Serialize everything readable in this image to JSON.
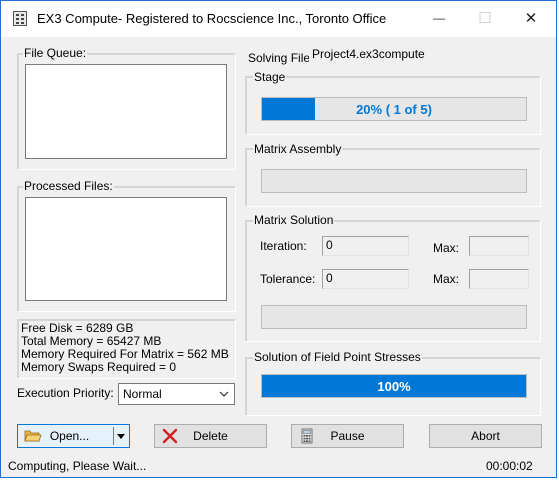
{
  "window": {
    "title": "EX3 Compute- Registered to Rocscience Inc., Toronto Office"
  },
  "titlebar_buttons": {
    "minimize": "—",
    "maximize": "☐",
    "close": "✕"
  },
  "left": {
    "file_queue_label": "File Queue:",
    "processed_files_label": "Processed Files:",
    "memory_info": [
      "Free Disk = 6289 GB",
      "Total Memory = 65427 MB",
      "Memory Required For Matrix = 562 MB",
      "Memory Swaps Required = 0"
    ],
    "execution_priority_label": "Execution Priority:",
    "execution_priority_value": "Normal"
  },
  "right": {
    "solving_file_label": "Solving File:",
    "solving_file_value": "Project4.ex3compute",
    "stage": {
      "label": "Stage",
      "progress_fraction": 0.2,
      "text": "20%   ( 1 of 5)"
    },
    "matrix_assembly": {
      "label": "Matrix Assembly",
      "progress_fraction": 0.0,
      "text": ""
    },
    "matrix_solution": {
      "label": "Matrix Solution",
      "iteration_label": "Iteration:",
      "iteration_value": "0",
      "iteration_max_label": "Max:",
      "iteration_max_value": "",
      "tolerance_label": "Tolerance:",
      "tolerance_value": "0",
      "tolerance_max_label": "Max:",
      "tolerance_max_value": "",
      "progress_fraction": 0.0
    },
    "field_point": {
      "label": "Solution of Field Point Stresses",
      "progress_fraction": 1.0,
      "text": "100%"
    }
  },
  "buttons": {
    "open": "Open...",
    "delete": "Delete",
    "pause": "Pause",
    "abort": "Abort"
  },
  "status": {
    "message": "Computing, Please Wait...",
    "elapsed": "00:00:02"
  },
  "colors": {
    "progress_fill": "#0078d7",
    "progress_text_on_empty": "#0078d7",
    "progress_text_on_fill": "#ffffff",
    "window_border": "#1f6fd0"
  },
  "icons": {
    "app": "grid-app-icon",
    "open": "folder-open-icon",
    "delete": "red-x-icon",
    "pause": "calculator-icon",
    "dropdown": "chevron-down-icon"
  }
}
